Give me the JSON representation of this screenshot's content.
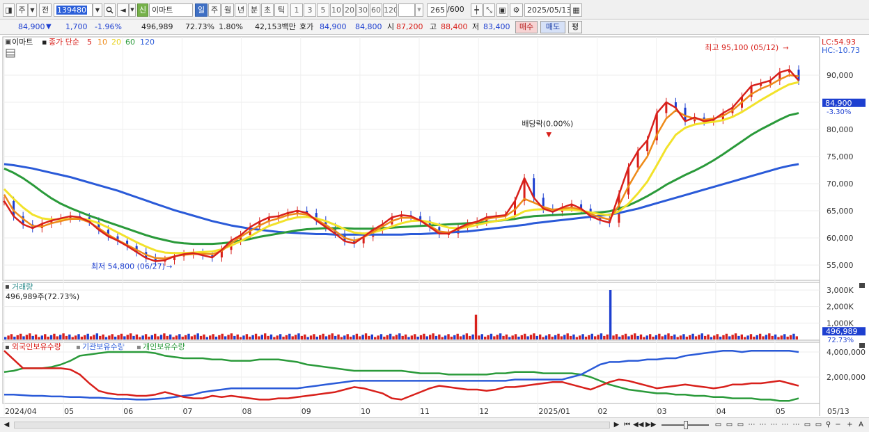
{
  "toolbar": {
    "market": "주",
    "prev_label": "전",
    "stock_code": "139480",
    "badge": "신",
    "stock_name": "이마트",
    "periods": [
      "일",
      "주",
      "월",
      "년",
      "분",
      "초",
      "틱"
    ],
    "active_period": "일",
    "intervals": [
      "1",
      "3",
      "5",
      "10",
      "20",
      "30",
      "60",
      "120"
    ],
    "count": "265",
    "count_total": "/600",
    "date": "2025/05/13"
  },
  "quote": {
    "price": "84,900",
    "change": "1,700",
    "change_pct": "-1.96%",
    "volume": "496,989",
    "vol_ratio": "72.73%",
    "turnover": "1.80%",
    "amount": "42,153백만",
    "hoga_label": "호가",
    "ask": "84,900",
    "bid": "84,800",
    "open_label": "시",
    "open": "87,200",
    "high_label": "고",
    "high": "88,400",
    "low_label": "저",
    "low": "83,400",
    "buy_label": "매수",
    "sell_label": "매도",
    "eval_label": "평"
  },
  "chart_data": [
    {
      "type": "line",
      "panel": "price",
      "stock": "이마트",
      "legend": [
        "종가 단순",
        "5",
        "10",
        "20",
        "60",
        "120"
      ],
      "legend_colors": [
        "#d8201b",
        "#d8201b",
        "#ee8a18",
        "#e8d21a",
        "#2a9a3a",
        "#2a5ad8"
      ],
      "y_ticks": [
        "90,000",
        "85,000",
        "80,000",
        "75,000",
        "70,000",
        "65,000",
        "60,000",
        "55,000"
      ],
      "ylim": [
        53000,
        97000
      ],
      "x_ticks": [
        "2024/04",
        "05",
        "06",
        "07",
        "08",
        "09",
        "10",
        "11",
        "12",
        "2025/01",
        "02",
        "03",
        "04",
        "05",
        "05/13"
      ],
      "price_label": "84,900",
      "price_change_label": "-3.30%",
      "lc_label": "LC:54.93",
      "hc_label": "HC:-10.73",
      "high_annotation": "최고 95,100 (05/12)",
      "low_annotation": "최저 54,800 (06/27)",
      "dividend_annotation": "배당락(0.00%)",
      "x_months": [
        0,
        1,
        2,
        3,
        4,
        5,
        6,
        7,
        8,
        9,
        10,
        11,
        12,
        13,
        13.4
      ],
      "close_ma5": [
        66800,
        64000,
        62500,
        61800,
        62600,
        63200,
        63600,
        64000,
        63800,
        63000,
        61500,
        60300,
        59500,
        58500,
        57400,
        56300,
        55700,
        55900,
        56600,
        57000,
        57200,
        56800,
        56400,
        57800,
        59500,
        60500,
        62000,
        63000,
        63800,
        64000,
        64600,
        65000,
        64600,
        63200,
        62000,
        60800,
        59400,
        59000,
        60200,
        61500,
        62500,
        63800,
        64200,
        64000,
        63200,
        62000,
        60800,
        60800,
        61800,
        62600,
        63000,
        63800,
        64000,
        64200,
        66800,
        71000,
        67400,
        65400,
        64800,
        65600,
        66200,
        65400,
        64000,
        63300,
        62800,
        68000,
        73000,
        76000,
        78000,
        83000,
        85000,
        84000,
        81500,
        82200,
        81500,
        81800,
        83000,
        84000,
        86000,
        88000,
        88500,
        89000,
        90500,
        91000,
        89000
      ],
      "ma10": [
        68000,
        65000,
        63500,
        62200,
        62100,
        62700,
        63100,
        63500,
        63500,
        62900,
        61800,
        60600,
        59600,
        58700,
        57800,
        56900,
        56300,
        56200,
        56600,
        56900,
        57000,
        57100,
        57000,
        57600,
        59000,
        60200,
        61300,
        62300,
        63100,
        63600,
        64200,
        64500,
        64300,
        63400,
        62400,
        61300,
        60000,
        59500,
        60100,
        61100,
        62100,
        63100,
        63700,
        63700,
        63200,
        62200,
        61200,
        61000,
        61600,
        62300,
        62900,
        63500,
        63800,
        64000,
        65200,
        67200,
        66500,
        65700,
        65200,
        65400,
        65600,
        65200,
        64400,
        63800,
        63400,
        66000,
        69500,
        72500,
        75000,
        79000,
        82000,
        83500,
        82500,
        82000,
        81800,
        82000,
        82500,
        83500,
        85000,
        86500,
        87500,
        88200,
        89200,
        90000,
        89800
      ],
      "ma20": [
        69000,
        67200,
        65600,
        64300,
        63600,
        63400,
        63400,
        63500,
        63600,
        63300,
        62700,
        61900,
        61000,
        60100,
        59200,
        58400,
        57700,
        57300,
        57200,
        57200,
        57300,
        57400,
        57500,
        57900,
        58600,
        59400,
        60300,
        61300,
        62200,
        62800,
        63400,
        63800,
        63900,
        63600,
        63100,
        62400,
        61600,
        61000,
        60800,
        61000,
        61500,
        62100,
        62700,
        63100,
        63200,
        62900,
        62400,
        61900,
        61800,
        62000,
        62400,
        62800,
        63100,
        63400,
        64000,
        64900,
        65200,
        65300,
        65200,
        65200,
        65200,
        65000,
        64700,
        64400,
        64200,
        64900,
        66300,
        68200,
        70400,
        73400,
        76500,
        79000,
        80300,
        80900,
        81200,
        81400,
        81700,
        82300,
        83200,
        84300,
        85400,
        86400,
        87400,
        88300,
        88700
      ],
      "ma60": [
        72800,
        72000,
        71000,
        69800,
        68500,
        67300,
        66300,
        65500,
        64800,
        64100,
        63500,
        62900,
        62300,
        61700,
        61100,
        60500,
        60000,
        59600,
        59200,
        59000,
        58900,
        58900,
        58900,
        59000,
        59200,
        59500,
        59800,
        60200,
        60500,
        60800,
        61100,
        61400,
        61600,
        61700,
        61800,
        61800,
        61800,
        61700,
        61700,
        61700,
        61800,
        61900,
        62000,
        62100,
        62200,
        62300,
        62400,
        62500,
        62600,
        62700,
        62800,
        62900,
        63100,
        63300,
        63500,
        63800,
        64000,
        64100,
        64200,
        64300,
        64400,
        64500,
        64600,
        64700,
        64900,
        65400,
        66000,
        66800,
        67700,
        68700,
        69800,
        70700,
        71600,
        72400,
        73300,
        74300,
        75400,
        76600,
        77800,
        79000,
        80000,
        80900,
        81800,
        82600,
        83000
      ],
      "ma120": [
        73600,
        73400,
        73100,
        72800,
        72400,
        72000,
        71600,
        71200,
        70700,
        70200,
        69700,
        69200,
        68700,
        68100,
        67500,
        66900,
        66300,
        65700,
        65100,
        64600,
        64100,
        63600,
        63100,
        62700,
        62300,
        62000,
        61700,
        61500,
        61300,
        61100,
        61000,
        60900,
        60800,
        60700,
        60700,
        60600,
        60600,
        60600,
        60600,
        60600,
        60600,
        60600,
        60600,
        60700,
        60700,
        60800,
        60900,
        61000,
        61100,
        61200,
        61400,
        61600,
        61800,
        62000,
        62200,
        62400,
        62700,
        62900,
        63100,
        63300,
        63500,
        63700,
        63900,
        64100,
        64300,
        64600,
        65000,
        65400,
        65900,
        66400,
        66900,
        67400,
        67900,
        68400,
        68900,
        69400,
        69900,
        70400,
        70900,
        71400,
        71900,
        72400,
        72900,
        73300,
        73600
      ]
    },
    {
      "type": "bar",
      "panel": "volume",
      "title": "거래량",
      "volume_text": "496,989주(72.73%)",
      "y_ticks": [
        "3,000K",
        "2,000K",
        "1,000K"
      ],
      "ylim": [
        0,
        3300000
      ],
      "current_volume": "496,989",
      "current_ratio": "72.73%",
      "spikes": [
        {
          "month": 7.95,
          "value": 1500000
        },
        {
          "month": 10.2,
          "value": 3000000
        }
      ]
    },
    {
      "type": "line",
      "panel": "holdings",
      "series_names": [
        "외국인보유수량",
        "기관보유수량",
        "개인보유수량"
      ],
      "series_colors": [
        "#d8201b",
        "#2a5ad8",
        "#2a9a3a"
      ],
      "y_ticks": [
        "4,000,000",
        "2,000,000"
      ],
      "ylim": [
        0,
        4700000
      ],
      "foreign": [
        4100000,
        3400000,
        2700000,
        2700000,
        2700000,
        2700000,
        2700000,
        2600000,
        2200000,
        1500000,
        900000,
        700000,
        600000,
        600000,
        500000,
        500000,
        600000,
        800000,
        600000,
        400000,
        300000,
        300000,
        500000,
        400000,
        500000,
        400000,
        300000,
        200000,
        200000,
        300000,
        300000,
        400000,
        500000,
        600000,
        700000,
        800000,
        1000000,
        1200000,
        1100000,
        900000,
        700000,
        300000,
        200000,
        500000,
        800000,
        1100000,
        1300000,
        1200000,
        1100000,
        1000000,
        1000000,
        900000,
        1000000,
        1200000,
        1200000,
        1300000,
        1400000,
        1500000,
        1600000,
        1600000,
        1400000,
        1200000,
        1000000,
        1300000,
        1600000,
        1800000,
        1700000,
        1500000,
        1300000,
        1100000,
        1200000,
        1300000,
        1400000,
        1300000,
        1200000,
        1100000,
        1200000,
        1400000,
        1400000,
        1500000,
        1500000,
        1600000,
        1700000,
        1500000,
        1300000
      ],
      "institution": [
        600000,
        600000,
        550000,
        500000,
        500000,
        450000,
        450000,
        400000,
        400000,
        350000,
        350000,
        300000,
        250000,
        250000,
        200000,
        200000,
        250000,
        300000,
        400000,
        500000,
        600000,
        800000,
        900000,
        1000000,
        1100000,
        1100000,
        1100000,
        1100000,
        1100000,
        1100000,
        1100000,
        1100000,
        1200000,
        1300000,
        1400000,
        1500000,
        1600000,
        1700000,
        1700000,
        1700000,
        1700000,
        1700000,
        1700000,
        1700000,
        1700000,
        1700000,
        1700000,
        1700000,
        1700000,
        1700000,
        1700000,
        1700000,
        1700000,
        1700000,
        1800000,
        1800000,
        1800000,
        1800000,
        1800000,
        1800000,
        2000000,
        2200000,
        2600000,
        3000000,
        3200000,
        3200000,
        3300000,
        3300000,
        3400000,
        3400000,
        3500000,
        3500000,
        3700000,
        3800000,
        3900000,
        4000000,
        4100000,
        4100000,
        4000000,
        4100000,
        4100000,
        4100000,
        4100000,
        4100000,
        4000000
      ],
      "individual": [
        2400000,
        2500000,
        2700000,
        2700000,
        2700000,
        2800000,
        3000000,
        3300000,
        3700000,
        3800000,
        3900000,
        4000000,
        4000000,
        4000000,
        4000000,
        4000000,
        3900000,
        3700000,
        3600000,
        3500000,
        3500000,
        3500000,
        3400000,
        3400000,
        3300000,
        3300000,
        3300000,
        3400000,
        3400000,
        3400000,
        3300000,
        3200000,
        3000000,
        2900000,
        2800000,
        2700000,
        2600000,
        2500000,
        2500000,
        2500000,
        2500000,
        2500000,
        2500000,
        2400000,
        2300000,
        2300000,
        2300000,
        2200000,
        2200000,
        2200000,
        2200000,
        2200000,
        2300000,
        2300000,
        2400000,
        2400000,
        2400000,
        2300000,
        2300000,
        2300000,
        2300000,
        2200000,
        2000000,
        1700000,
        1400000,
        1200000,
        1000000,
        900000,
        800000,
        700000,
        700000,
        600000,
        600000,
        500000,
        500000,
        400000,
        400000,
        300000,
        300000,
        300000,
        200000,
        200000,
        100000,
        100000,
        300000
      ]
    }
  ],
  "bottom": {
    "icons": [
      "play-icon",
      "first-icon",
      "prev-icon",
      "next-icon",
      "zoom-out-icon",
      "minus-icon",
      "plus-icon",
      "text-icon"
    ]
  }
}
